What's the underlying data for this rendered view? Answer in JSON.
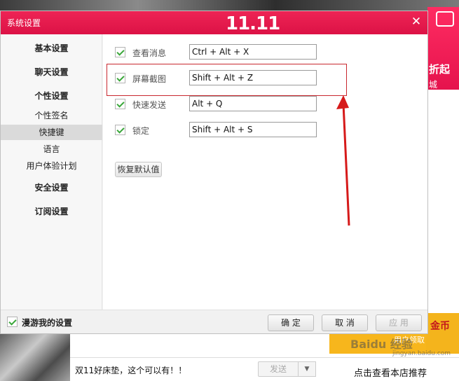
{
  "background": {
    "banner_discount": "折起",
    "banner_sub": "城",
    "gold_text": "金币",
    "promo_text": "用户领取",
    "chat_text": "双11好床垫，这个可以有！！",
    "send_label": "发送",
    "shop_link": "点击查看本店推荐",
    "watermark": "Baidu 经验",
    "watermark_sub": "jingyan.baidu.com"
  },
  "dialog": {
    "title": "系统设置",
    "brand": "11.11",
    "close_glyph": "✕"
  },
  "sidebar": {
    "items": [
      {
        "label": "基本设置"
      },
      {
        "label": "聊天设置"
      },
      {
        "label": "个性设置"
      },
      {
        "label": "个性签名"
      },
      {
        "label": "快捷键"
      },
      {
        "label": "语言"
      },
      {
        "label": "用户体验计划"
      },
      {
        "label": "安全设置"
      },
      {
        "label": "订阅设置"
      }
    ]
  },
  "shortcuts": {
    "rows": [
      {
        "label": "查看消息",
        "value": "Ctrl + Alt + X",
        "checked": true
      },
      {
        "label": "屏幕截图",
        "value": "Shift + Alt + Z",
        "checked": true
      },
      {
        "label": "快速发送",
        "value": "Alt + Q",
        "checked": true
      },
      {
        "label": "锁定",
        "value": "Shift + Alt + S",
        "checked": true
      }
    ],
    "reset_label": "恢复默认值"
  },
  "footer": {
    "roam_label": "漫游我的设置",
    "ok_label": "确 定",
    "cancel_label": "取 消",
    "apply_label": "应 用"
  },
  "colors": {
    "accent": "#e0174c",
    "check": "#3aa73a",
    "highlight": "#c9282f"
  }
}
